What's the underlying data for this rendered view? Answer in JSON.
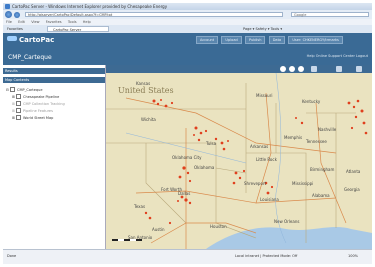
{
  "browser": {
    "window_title": "CartoPac Server - Windows Internet Explorer provided by Chesapeake Energy",
    "address": "http://gisarver/CartoPac/Default.aspx?f=CMP.tpt",
    "search_placeholder": "Google",
    "menu": [
      "File",
      "Edit",
      "View",
      "Favorites",
      "Tools",
      "Help"
    ],
    "favorites_label": "Favorites",
    "tab_title": "CartoPac Server",
    "command_bar": "Page ▾  Safety ▾  Tools ▾"
  },
  "app": {
    "logo_text": "CartoPac",
    "top_links": [
      "Account",
      "Upload",
      "Publish",
      "Data",
      "User: CHKENERGY/trmarks"
    ],
    "title": "CMP_Carteque",
    "user_links": "Help  Online Support Center  Logout"
  },
  "left_panel": {
    "results_header": "Results",
    "layers_header": "Map Contents",
    "tree": [
      {
        "label": "CMP_Carteque",
        "level": 0
      },
      {
        "label": "Chesapeake Pipeline",
        "level": 1
      },
      {
        "label": "CMP Collection Tracking",
        "level": 1
      },
      {
        "label": "Pipeline Features",
        "level": 1
      },
      {
        "label": "World Street Map",
        "level": 1
      }
    ]
  },
  "map": {
    "country_label": "United States",
    "labels": [
      "Kansas",
      "Wichita",
      "Oklahoma City",
      "Oklahoma",
      "Tulsa",
      "Fort Worth",
      "Dallas",
      "Texas",
      "Austin",
      "San Antonio",
      "Houston",
      "Arkansas",
      "Louisiana",
      "Mississippi",
      "Memphis",
      "Birmingham",
      "Atlanta",
      "Nashville",
      "Tennessee",
      "Kentucky",
      "Georgia",
      "Alabama",
      "New Orleans",
      "Shreveport",
      "Little Rock",
      "Missouri"
    ],
    "colors": {
      "land": "#eae3c0",
      "state_line": "#b9a97c",
      "road": "#d98a4c",
      "water": "#a9c9e6",
      "well": "#e0401e"
    }
  },
  "status": {
    "left": "Done",
    "zone": "Local intranet | Protected Mode: Off",
    "zoom": "100%"
  }
}
